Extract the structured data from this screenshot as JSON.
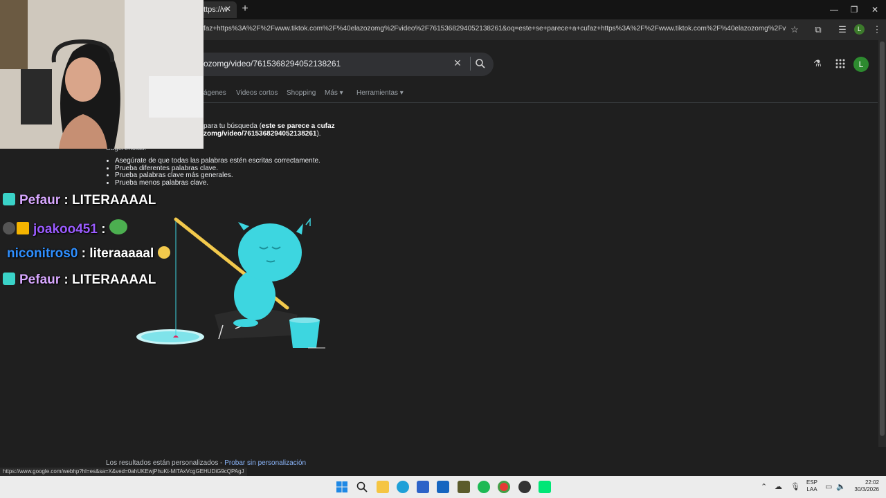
{
  "browser": {
    "tab_title": "ttps://w",
    "url": "faz+https%3A%2F%2Fwww.tiktok.com%2F%40elazozomg%2Fvideo%2F7615368294052138261&oq=este+se+parece+a+cufaz+https%3A%2F%2Fwww.tiktok.com%2F%40elazozomg%2Fvideo%2F761536...",
    "profile_letter": "L",
    "status_url": "https://www.google.com/webhp?hl=es&sa=X&ved=0ahUKEwjPhuKt-MiTAxVcgGEHUDiG9cQPAgJ"
  },
  "google": {
    "search_query": "ozomg/video/7615368294052138261",
    "avatar_letter": "L",
    "nav_tabs": [
      "ágenes",
      "Videos cortos",
      "Shopping",
      "Más ▾",
      "Herramientas ▾"
    ],
    "no_results_prefix": "para tu búsqueda (",
    "no_results_query": "este se parece a cufaz zomg/video/7615368294052138261",
    "no_results_suffix": ").",
    "suggestions_label": "Sugerencias:",
    "suggestions": [
      "Asegúrate de que todas las palabras estén escritas correctamente.",
      "Prueba diferentes palabras clave.",
      "Prueba palabras clave más generales.",
      "Prueba menos palabras clave."
    ],
    "footer_text": "Los resultados están personalizados - ",
    "footer_link": "Probar sin personalización"
  },
  "chat": [
    {
      "user": "Pefaur",
      "message": "LITERAAAAL",
      "user_color": "#d8a8ff"
    },
    {
      "user": "joakoo451",
      "message": "",
      "user_color": "#9b5cff"
    },
    {
      "user": "niconitros0",
      "message": "literaaaaal",
      "user_color": "#2f8fff"
    },
    {
      "user": "Pefaur",
      "message": "LITERAAAAL",
      "user_color": "#d8a8ff"
    }
  ],
  "taskbar": {
    "lang_1": "ESP",
    "lang_2": "LAA",
    "time": "22:02",
    "date": "30/3/2026"
  },
  "colors": {
    "accent": "#8ab4f8",
    "illustration": "#3dd6e0"
  }
}
